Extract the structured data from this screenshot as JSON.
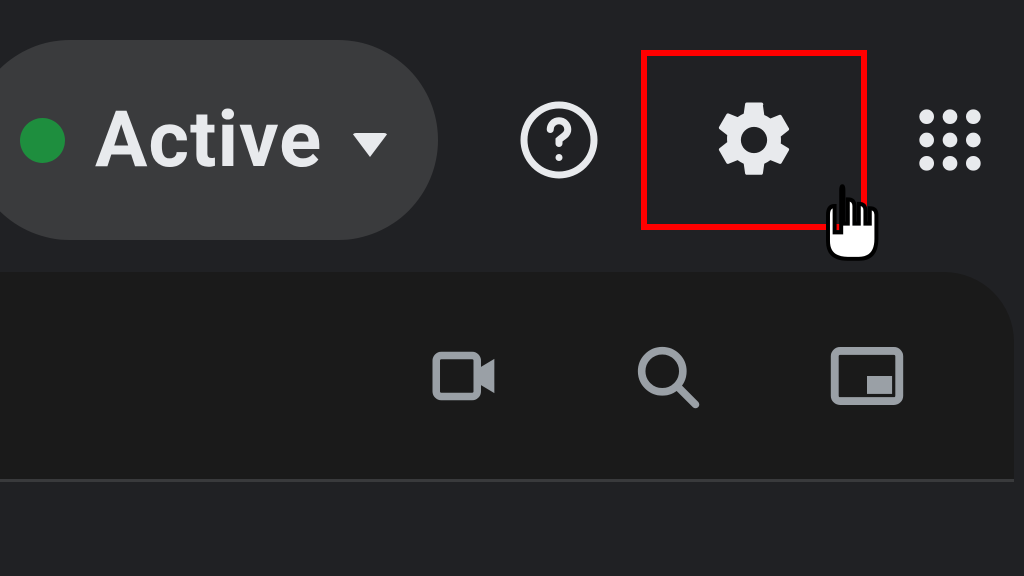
{
  "status": {
    "label": "Active",
    "color": "#1e8e3e"
  },
  "icons": {
    "help": "help-icon",
    "settings": "gear-icon",
    "apps": "apps-grid-icon",
    "video": "video-icon",
    "search": "search-icon",
    "pip": "picture-in-picture-icon"
  },
  "highlight": {
    "target": "settings",
    "color": "#ff0000"
  }
}
